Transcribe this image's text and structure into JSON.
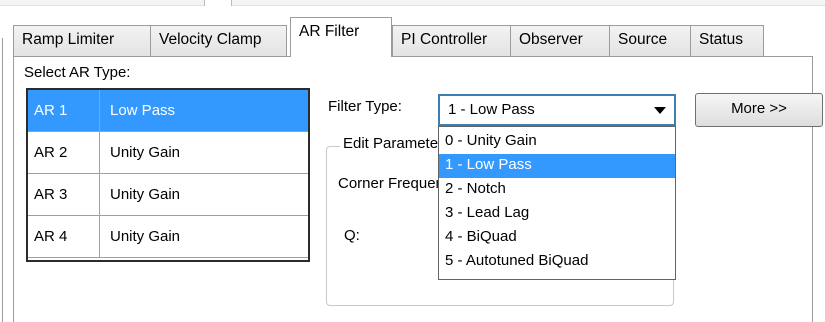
{
  "tabs": [
    {
      "label": "Ramp Limiter",
      "active": false
    },
    {
      "label": "Velocity Clamp",
      "active": false
    },
    {
      "label": "AR Filter",
      "active": true
    },
    {
      "label": "PI Controller",
      "active": false
    },
    {
      "label": "Observer",
      "active": false
    },
    {
      "label": "Source",
      "active": false
    },
    {
      "label": "Status",
      "active": false
    }
  ],
  "select_ar_label": "Select AR Type:",
  "ar_list": [
    {
      "id": "AR 1",
      "type": "Low Pass",
      "selected": true
    },
    {
      "id": "AR 2",
      "type": "Unity Gain",
      "selected": false
    },
    {
      "id": "AR 3",
      "type": "Unity Gain",
      "selected": false
    },
    {
      "id": "AR 4",
      "type": "Unity Gain",
      "selected": false
    }
  ],
  "filter_type": {
    "label": "Filter Type:",
    "selected_value": "1 - Low Pass",
    "options": [
      "0 - Unity Gain",
      "1 - Low Pass",
      "2 - Notch",
      "3 - Lead Lag",
      "4 - BiQuad",
      "5 - Autotuned BiQuad"
    ],
    "highlighted_index": 1
  },
  "more_button": "More >>",
  "edit_group": {
    "title": "Edit Parameters",
    "corner_freq_label": "Corner Frequency:",
    "q_label": "Q:"
  },
  "colors": {
    "selection": "#3399ff",
    "combo_border": "#3c7fb1"
  }
}
